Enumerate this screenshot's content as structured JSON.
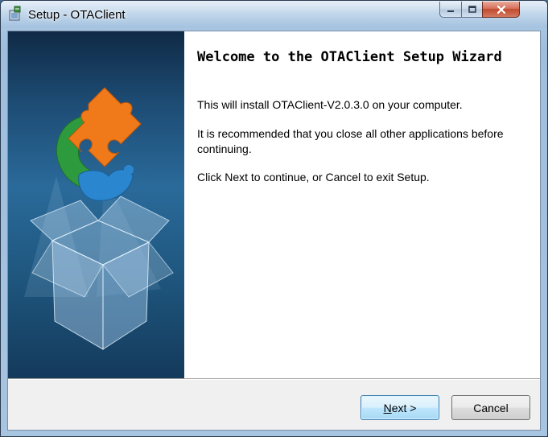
{
  "window": {
    "title": "Setup - OTAClient",
    "icons": {
      "app": "setup-app-icon",
      "minimize": "minimize-icon",
      "maximize": "maximize-icon",
      "close": "close-icon"
    }
  },
  "wizard": {
    "title": "Welcome to the OTAClient Setup Wizard",
    "paragraphs": [
      "This will install OTAClient-V2.0.3.0 on your computer.",
      "It is recommended that you close all other applications before continuing.",
      "Click Next to continue, or Cancel to exit Setup."
    ],
    "side_image": "puzzle-box-illustration"
  },
  "buttons": {
    "next_accel": "N",
    "next_rest": "ext >",
    "cancel": "Cancel"
  },
  "colors": {
    "accent": "#3c7fb1",
    "puzzle_orange": "#f07a1a",
    "puzzle_green": "#2e9a3e",
    "puzzle_blue": "#2b86d0"
  }
}
